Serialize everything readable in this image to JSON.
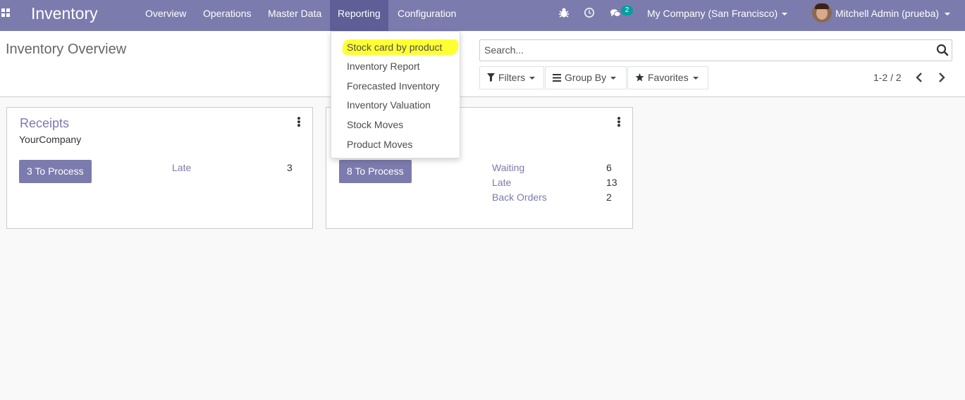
{
  "navbar": {
    "brand": "Inventory",
    "menu": [
      {
        "label": "Overview"
      },
      {
        "label": "Operations"
      },
      {
        "label": "Master Data"
      },
      {
        "label": "Reporting"
      },
      {
        "label": "Configuration"
      }
    ],
    "active_menu": "Reporting",
    "message_count": "2",
    "company": "My Company (San Francisco)",
    "user": "Mitchell Admin (prueba)",
    "icons": [
      "apps-icon",
      "bug-icon",
      "clock-icon",
      "chat-icon",
      "caret-down-icon"
    ]
  },
  "control_panel": {
    "title": "Inventory Overview",
    "search_placeholder": "Search...",
    "filters_label": "Filters",
    "groupby_label": "Group By",
    "favorites_label": "Favorites",
    "pager": "1-2 / 2"
  },
  "reporting_menu": {
    "items": [
      {
        "label": "Stock card by product",
        "highlighted": true
      },
      {
        "label": "Inventory Report"
      },
      {
        "label": "Forecasted Inventory"
      },
      {
        "label": "Inventory Valuation"
      },
      {
        "label": "Stock Moves"
      },
      {
        "label": "Product Moves"
      }
    ]
  },
  "cards": [
    {
      "title": "Receipts",
      "subtitle": "YourCompany",
      "button": "3 To Process",
      "stats": [
        {
          "label": "Late",
          "value": "3"
        }
      ]
    },
    {
      "button": "8 To Process",
      "stats": [
        {
          "label": "Waiting",
          "value": "6"
        },
        {
          "label": "Late",
          "value": "13"
        },
        {
          "label": "Back Orders",
          "value": "2"
        }
      ]
    }
  ],
  "colors": {
    "brand": "#7c7bad",
    "active_menu_bg": "#5f5e97",
    "highlight": "#ffff33",
    "badge": "#00a09d"
  }
}
